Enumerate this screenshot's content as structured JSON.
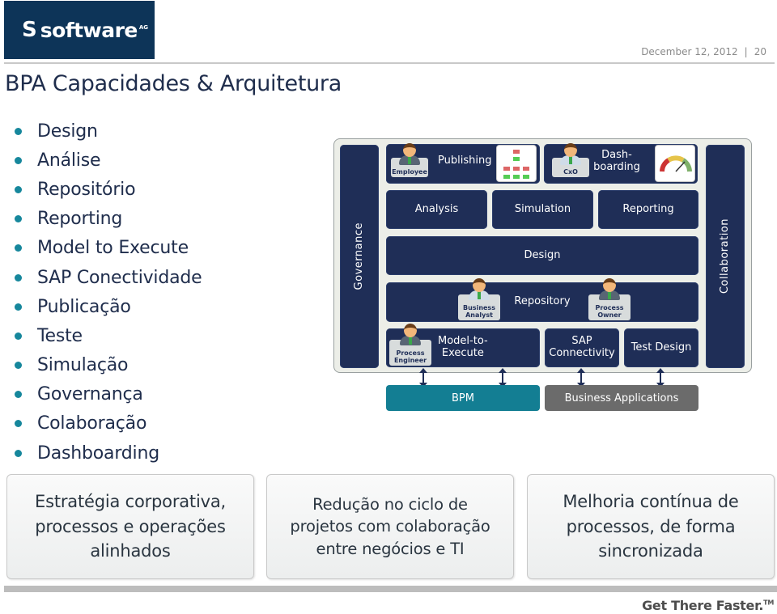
{
  "header": {
    "logo": {
      "mark": "S",
      "text": "software",
      "suffix": "AG"
    },
    "date": "December 12, 2012",
    "separator": "|",
    "page_number": "20",
    "title": "BPA Capacidades & Arquitetura"
  },
  "bullets": [
    "Design",
    "Análise",
    "Repositório",
    "Reporting",
    "Model to Execute",
    "SAP Conectividade",
    "Publicação",
    "Teste",
    "Simulação",
    "Governança",
    "Colaboração",
    "Dashboarding"
  ],
  "architecture": {
    "left_column": "Governance",
    "right_column": "Collaboration",
    "row1": {
      "publishing": "Publishing",
      "dashboarding": "Dash-\nboarding"
    },
    "row2": {
      "analysis": "Analysis",
      "simulation": "Simulation",
      "reporting": "Reporting"
    },
    "row3": {
      "design": "Design"
    },
    "row4": {
      "repository": "Repository"
    },
    "row5": {
      "model_to_execute": "Model-to-\nExecute",
      "sap_connectivity": "SAP\nConnectivity",
      "test_design": "Test Design"
    },
    "roles": {
      "employee": "Employee",
      "cxo": "CxO",
      "business_analyst": "Business\nAnalyst",
      "process_owner": "Process\nOwner",
      "process_engineer": "Process\nEngineer"
    },
    "bpm": "BPM",
    "business_applications": "Business Applications"
  },
  "benefits": [
    "Estratégia corporativa,\nprocessos e operações\nalinhados",
    "Redução no ciclo de\nprojetos com colaboração\nentre negócios e TI",
    "Melhoria contínua de\nprocessos, de forma\nsincronizada"
  ],
  "footer": {
    "tagline": "Get There Faster.",
    "trademark": "TM"
  },
  "colors": {
    "brand_navy": "#0d3458",
    "diagram_navy": "#1f2e57",
    "teal": "#137e93",
    "bullet": "#16879c",
    "gray_block": "#6b6b6b"
  }
}
